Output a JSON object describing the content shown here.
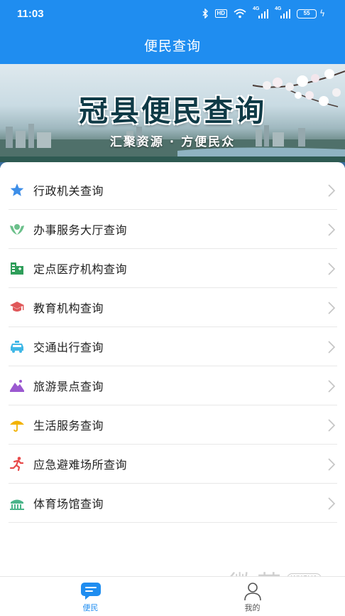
{
  "status_bar": {
    "time": "11:03",
    "hd_label": "HD",
    "net1": "4G",
    "net2": "4G",
    "battery": "55"
  },
  "header": {
    "title": "便民查询"
  },
  "banner": {
    "title": "冠县便民查询",
    "subtitle": "汇聚资源 · 方便民众"
  },
  "menu": [
    {
      "label": "行政机关查询",
      "icon": "star-icon",
      "color": "#3d8ee8"
    },
    {
      "label": "办事服务大厅查询",
      "icon": "service-hall-icon",
      "color": "#6cc08b"
    },
    {
      "label": "定点医疗机构查询",
      "icon": "hospital-icon",
      "color": "#2f9e5a"
    },
    {
      "label": "教育机构查询",
      "icon": "graduation-cap-icon",
      "color": "#e0585a"
    },
    {
      "label": "交通出行查询",
      "icon": "taxi-icon",
      "color": "#3fb7e6"
    },
    {
      "label": "旅游景点查询",
      "icon": "mountain-icon",
      "color": "#9b59d0"
    },
    {
      "label": "生活服务查询",
      "icon": "umbrella-icon",
      "color": "#f2b200"
    },
    {
      "label": "应急避难场所查询",
      "icon": "running-man-icon",
      "color": "#e84a4a"
    },
    {
      "label": "体育场馆查询",
      "icon": "stadium-icon",
      "color": "#4cb58a"
    }
  ],
  "bottom_nav": {
    "tab_home": "便民",
    "tab_mine": "我的",
    "active_color": "#1f8df0"
  },
  "watermark": {
    "text": "微茶",
    "badge": "WXCHA"
  }
}
